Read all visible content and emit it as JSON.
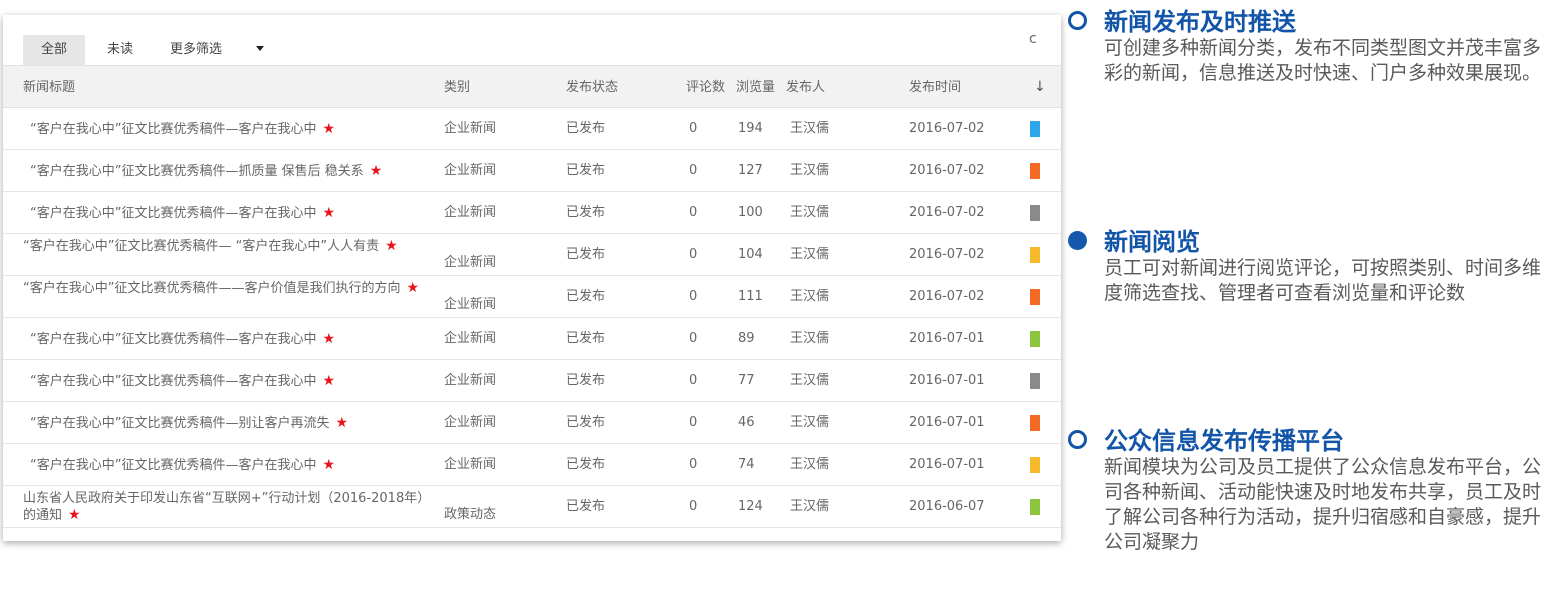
{
  "toolbar": {
    "tabs": [
      "全部",
      "未读",
      "更多筛选"
    ],
    "refresh_icon": "refresh-icon"
  },
  "table": {
    "columns": {
      "title": "新闻标题",
      "category": "类别",
      "status": "发布状态",
      "comments": "评论数",
      "views": "浏览量",
      "author": "发布人",
      "date": "发布时间"
    },
    "rows": [
      {
        "title": "“客户在我心中”征文比赛优秀稿件—客户在我心中",
        "category": "企业新闻",
        "status": "已发布",
        "comments": "0",
        "views": "194",
        "author": "王汉儒",
        "date": "2016-07-02",
        "color": "#2ea6e9"
      },
      {
        "title": "“客户在我心中”征文比赛优秀稿件—抓质量 保售后 稳关系",
        "category": "企业新闻",
        "status": "已发布",
        "comments": "0",
        "views": "127",
        "author": "王汉儒",
        "date": "2016-07-02",
        "color": "#f26a24"
      },
      {
        "title": "“客户在我心中”征文比赛优秀稿件—客户在我心中",
        "category": "企业新闻",
        "status": "已发布",
        "comments": "0",
        "views": "100",
        "author": "王汉儒",
        "date": "2016-07-02",
        "color": "#8a8a8a"
      },
      {
        "title": "“客户在我心中”征文比赛优秀稿件— “客户在我心中”人人有责",
        "category": "企业新闻",
        "status": "已发布",
        "comments": "0",
        "views": "104",
        "author": "王汉儒",
        "date": "2016-07-02",
        "color": "#f6b92b"
      },
      {
        "title": "“客户在我心中”征文比赛优秀稿件——客户价值是我们执行的方向",
        "category": "企业新闻",
        "status": "已发布",
        "comments": "0",
        "views": "111",
        "author": "王汉儒",
        "date": "2016-07-02",
        "color": "#f26a24"
      },
      {
        "title": "“客户在我心中”征文比赛优秀稿件—客户在我心中",
        "category": "企业新闻",
        "status": "已发布",
        "comments": "0",
        "views": "89",
        "author": "王汉儒",
        "date": "2016-07-01",
        "color": "#8cc63f"
      },
      {
        "title": "“客户在我心中”征文比赛优秀稿件—客户在我心中",
        "category": "企业新闻",
        "status": "已发布",
        "comments": "0",
        "views": "77",
        "author": "王汉儒",
        "date": "2016-07-01",
        "color": "#8a8a8a"
      },
      {
        "title": "“客户在我心中”征文比赛优秀稿件—别让客户再流失",
        "category": "企业新闻",
        "status": "已发布",
        "comments": "0",
        "views": "46",
        "author": "王汉儒",
        "date": "2016-07-01",
        "color": "#f26a24"
      },
      {
        "title": "“客户在我心中”征文比赛优秀稿件—客户在我心中",
        "category": "企业新闻",
        "status": "已发布",
        "comments": "0",
        "views": "74",
        "author": "王汉儒",
        "date": "2016-07-01",
        "color": "#f6b92b"
      },
      {
        "title": "山东省人民政府关于印发山东省“互联网+”行动计划（2016-2018年）的通知",
        "category": "政策动态",
        "status": "已发布",
        "comments": "0",
        "views": "124",
        "author": "王汉儒",
        "date": "2016-06-07",
        "color": "#8cc63f"
      }
    ]
  },
  "features": [
    {
      "title": "新闻发布及时推送",
      "body": "可创建多种新闻分类，发布不同类型图文并茂丰富多彩的新闻，信息推送及时快速、门户多种效果展现。",
      "bullet": "open"
    },
    {
      "title": "新闻阅览",
      "body": "员工可对新闻进行阅览评论，可按照类别、时间多维度筛选查找、管理者可查看浏览量和评论数",
      "bullet": "filled"
    },
    {
      "title": "公众信息发布传播平台",
      "body": "新闻模块为公司及员工提供了公众信息发布平台，公司各种新闻、活动能快速及时地发布共享，员工及时了解公司各种行为活动，提升归宿感和自豪感，提升公司凝聚力",
      "bullet": "open"
    }
  ],
  "colors": {
    "accent": "#1255a8",
    "star": "#e8141a"
  }
}
